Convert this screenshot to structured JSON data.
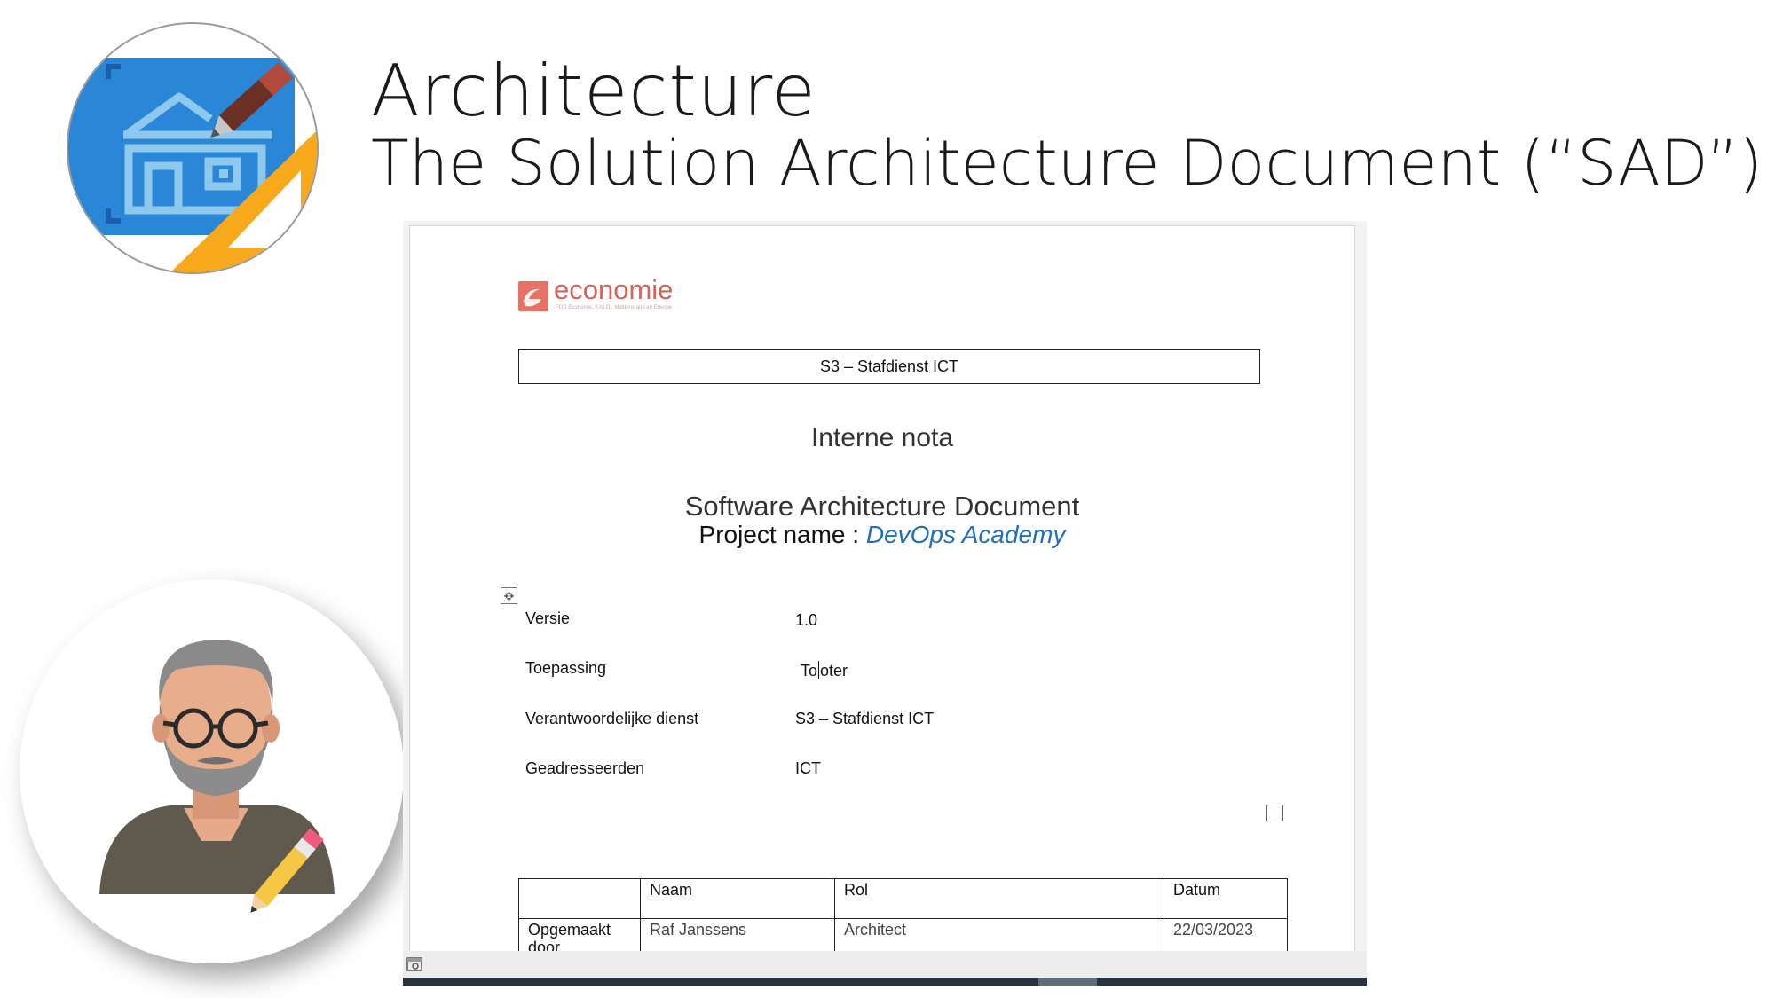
{
  "slide": {
    "title": "Architecture",
    "subtitle": "The Solution Architecture Document (“SAD”)"
  },
  "icons": {
    "blueprint": "blueprint-house-icon",
    "architect": "architect-avatar-icon"
  },
  "document": {
    "logo": {
      "word": "economie",
      "tagline": "FOD Economie, K.M.O., Middenstand en Energie"
    },
    "department_box": "S3 – Stafdienst ICT",
    "heading": "Interne nota",
    "doc_title": "Software Architecture Document",
    "project_label": "Project name : ",
    "project_name": "DevOps Academy",
    "meta": [
      {
        "label": "Versie",
        "value": "1.0"
      },
      {
        "label": "Toepassing",
        "value": "Tooter"
      },
      {
        "label": "Verantwoordelijke dienst",
        "value": "S3 – Stafdienst ICT"
      },
      {
        "label": "Geadresseerden",
        "value": "ICT"
      }
    ],
    "table": {
      "headers": [
        "",
        "Naam",
        "Rol",
        "Datum"
      ],
      "rows": [
        {
          "label": "Opgemaakt door",
          "naam": "Raf Janssens",
          "rol": "Architect",
          "datum": "22/03/2023"
        }
      ]
    }
  },
  "colors": {
    "accent_blue": "#1f6fc2",
    "logo_red": "#d4635a",
    "blueprint_blue": "#2e8ede",
    "scrollbar": "#27333f"
  }
}
